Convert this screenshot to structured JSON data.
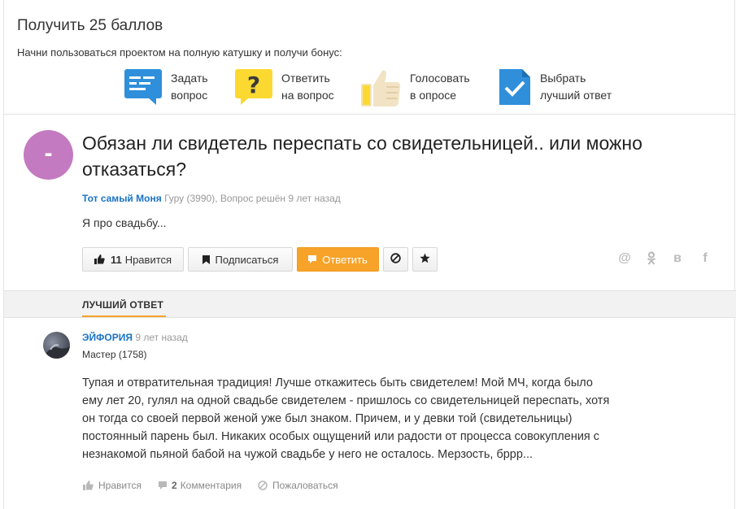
{
  "bonus": {
    "title": "Получить 25 баллов",
    "subtitle": "Начни пользоваться проектом на полную катушку и получи бонус:",
    "actions": [
      {
        "line1": "Задать",
        "line2": "вопрос",
        "icon": "question-bubble-icon"
      },
      {
        "line1": "Ответить",
        "line2": "на вопрос",
        "icon": "question-mark-icon"
      },
      {
        "line1": "Голосовать",
        "line2": "в опросе",
        "icon": "thumbs-up-icon"
      },
      {
        "line1": "Выбрать",
        "line2": "лучший ответ",
        "icon": "checkmark-doc-icon"
      }
    ]
  },
  "question": {
    "avatar_letter": "-",
    "title": "Обязан ли свидетель переспать со свидетельницей.. или можно отказаться?",
    "author": "Тот самый Моня",
    "meta": "Гуру (3990), Вопрос решён 9 лет назад",
    "text": "Я про свадьбу...",
    "like_count": "11",
    "like_label": "Нравится",
    "subscribe_label": "Подписаться",
    "reply_label": "Ответить"
  },
  "best_answer_label": "ЛУЧШИЙ ОТВЕТ",
  "answer": {
    "author": "ЭЙФОРИЯ",
    "time": "9 лет назад",
    "rank": "Мастер (1758)",
    "lines": [
      "Тупая и отвратительная традиция! Лучше откажитесь быть свидетелем! Мой МЧ, когда было",
      "ему лет 20, гулял на одной свадьбе свидетелем - пришлось со свидетельницей переспать, хотя",
      "он тогда со своей первой женой уже был знаком. Причем, и у девки той (свидетельницы)",
      "постоянный парень был. Никаких особых ощущений или радости от процесса совокупления с",
      "незнакомой пьяной бабой на чужой свадьбе у него не осталось. Мерзость, бррр..."
    ],
    "like_label": "Нравится",
    "comments_count": "2",
    "comments_label": "Комментария",
    "report_label": "Пожаловаться"
  },
  "colors": {
    "accent_orange": "#f7a32a",
    "link_blue": "#1a73c7",
    "avatar_purple": "#c37ac0"
  }
}
